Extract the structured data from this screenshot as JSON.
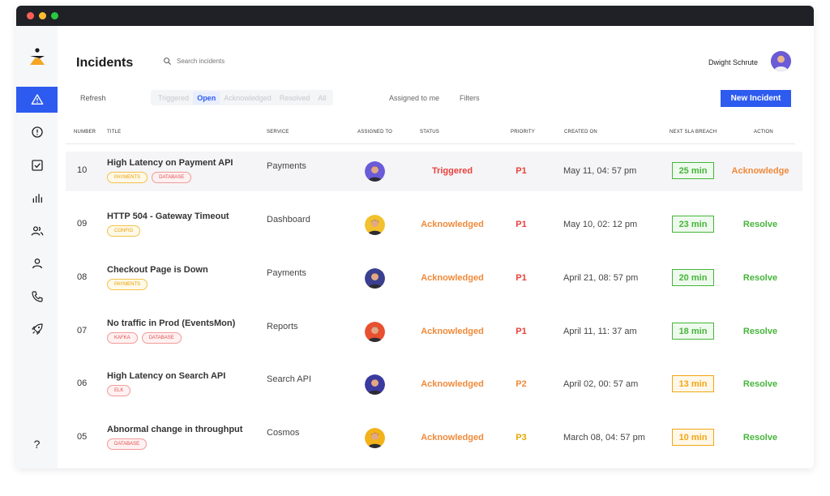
{
  "app": {
    "page_title": "Incidents",
    "search_placeholder": "Search incidents",
    "user_name": "Dwight Schrute"
  },
  "toolbar": {
    "refresh_label": "Refresh",
    "filter_tabs": [
      "Triggered",
      "Open",
      "Acknowledged",
      "Resolved",
      "All"
    ],
    "active_tab": "Open",
    "assigned_label": "Assigned to me",
    "filters_label": "Filters",
    "new_incident_label": "New Incident"
  },
  "sidebar": {
    "items": [
      {
        "icon": "alert-triangle-icon",
        "active": true
      },
      {
        "icon": "alert-circle-icon",
        "active": false
      },
      {
        "icon": "check-square-icon",
        "active": false
      },
      {
        "icon": "bar-chart-icon",
        "active": false
      },
      {
        "icon": "users-icon",
        "active": false
      },
      {
        "icon": "user-icon",
        "active": false
      },
      {
        "icon": "phone-icon",
        "active": false
      },
      {
        "icon": "rocket-icon",
        "active": false
      }
    ],
    "help_label": "?"
  },
  "table": {
    "headers": {
      "number": "NUMBER",
      "title": "TITLE",
      "service": "SERVICE",
      "assigned": "ASSIGNED TO",
      "status": "STATUS",
      "priority": "PRIORITY",
      "created": "CREATED ON",
      "sla": "NEXT SLA BREACH",
      "action": "ACTION"
    },
    "rows": [
      {
        "number": "10",
        "title": "High Latency on Payment API",
        "tags": [
          {
            "label": "PAYMENTS",
            "color": "yellow"
          },
          {
            "label": "DATABASE",
            "color": "red"
          }
        ],
        "service": "Payments",
        "avatar": "#6a5bd8",
        "status": "Triggered",
        "priority": "P1",
        "created": "May 11, 04: 57 pm",
        "sla": "25 min",
        "sla_color": "green",
        "action": "Acknowledge"
      },
      {
        "number": "09",
        "title": "HTTP 504 - Gateway Timeout",
        "tags": [
          {
            "label": "CONFIG",
            "color": "yellow"
          }
        ],
        "service": "Dashboard",
        "avatar": "#f2c12e",
        "status": "Acknowledged",
        "priority": "P1",
        "created": "May 10, 02: 12 pm",
        "sla": "23 min",
        "sla_color": "green",
        "action": "Resolve"
      },
      {
        "number": "08",
        "title": "Checkout Page is Down",
        "tags": [
          {
            "label": "PAYMENTS",
            "color": "yellow"
          }
        ],
        "service": "Payments",
        "avatar": "#3a3f8f",
        "status": "Acknowledged",
        "priority": "P1",
        "created": "April  21, 08: 57 pm",
        "sla": "20 min",
        "sla_color": "green",
        "action": "Resolve"
      },
      {
        "number": "07",
        "title": "No traffic in Prod (EventsMon)",
        "tags": [
          {
            "label": "KAFKA",
            "color": "red"
          },
          {
            "label": "DATABASE",
            "color": "red"
          }
        ],
        "service": "Reports",
        "avatar": "#e8502f",
        "status": "Acknowledged",
        "priority": "P1",
        "created": "April  11, 11: 37 am",
        "sla": "18 min",
        "sla_color": "green",
        "action": "Resolve"
      },
      {
        "number": "06",
        "title": "High Latency on Search API",
        "tags": [
          {
            "label": "ELK",
            "color": "red"
          }
        ],
        "service": "Search API",
        "avatar": "#3b3aa0",
        "status": "Acknowledged",
        "priority": "P2",
        "created": "April  02, 00: 57 am",
        "sla": "13 min",
        "sla_color": "amber",
        "action": "Resolve"
      },
      {
        "number": "05",
        "title": "Abnormal change in throughput",
        "tags": [
          {
            "label": "DATABASE",
            "color": "red"
          }
        ],
        "service": "Cosmos",
        "avatar": "#f2b21a",
        "status": "Acknowledged",
        "priority": "P3",
        "created": "March 08, 04: 57 pm",
        "sla": "10 min",
        "sla_color": "amber",
        "action": "Resolve"
      }
    ]
  }
}
